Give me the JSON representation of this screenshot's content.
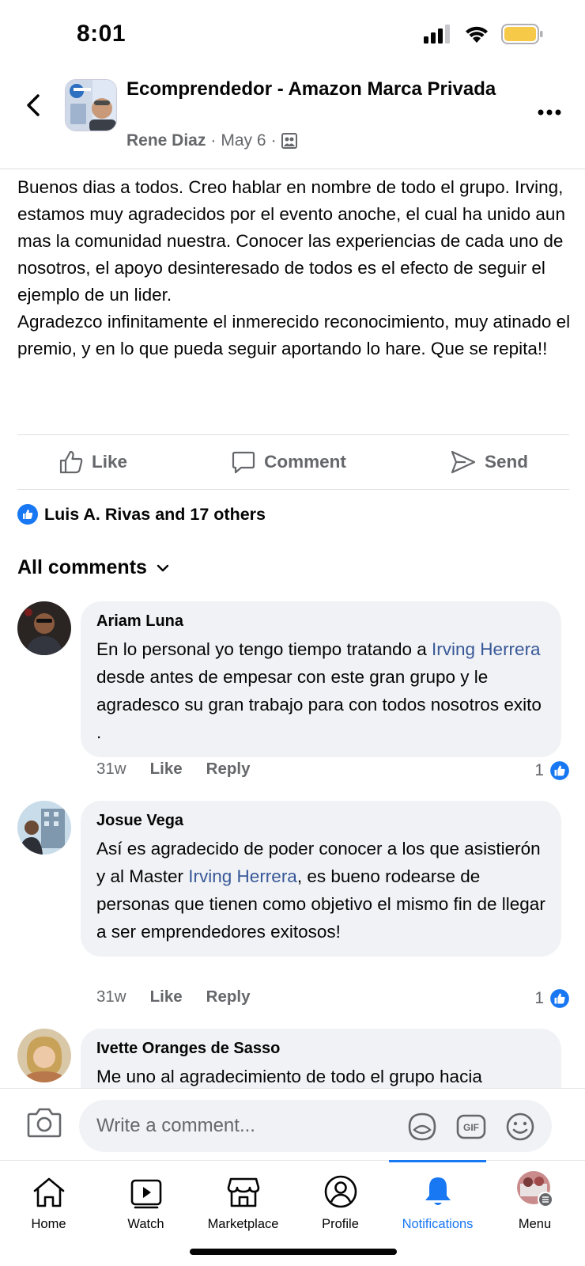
{
  "status_bar": {
    "time": "8:01"
  },
  "header": {
    "group_name": "Ecomprendedor - Amazon Marca Privada",
    "author": "Rene Diaz",
    "separator": "·",
    "date": "May 6",
    "separator2": "·"
  },
  "post": {
    "paragraph1": "Buenos dias a todos. Creo hablar en nombre de todo el grupo. Irving, estamos muy agradecidos por el evento anoche, el cual ha unido aun mas la comunidad nuestra. Conocer las experiencias de cada uno de nosotros, el apoyo desinteresado de todos es el efecto de seguir el ejemplo de un lider.",
    "paragraph2": "Agradezco infinitamente el inmerecido reconocimiento, muy atinado el premio, y en lo que pueda seguir aportando lo hare. Que se repita!!"
  },
  "actions": {
    "like": "Like",
    "comment": "Comment",
    "send": "Send"
  },
  "reactions": {
    "summary": "Luis A. Rivas and 17 others"
  },
  "comments_header": {
    "label": "All comments"
  },
  "comments": [
    {
      "name": "Ariam Luna",
      "text_before": "En lo personal yo tengo tiempo tratando a ",
      "mention": "Irving Herrera",
      "text_after": " desde antes de empesar con este gran grupo y le agradesco su gran trabajo para con todos nosotros exito .",
      "time": "31w",
      "like": "Like",
      "reply": "Reply",
      "reaction_count": "1"
    },
    {
      "name": "Josue Vega",
      "text_before": "Así es agradecido de poder conocer a los que asistierón y al Master ",
      "mention": "Irving Herrera",
      "text_after": ", es bueno rodearse de personas que tienen como objetivo el mismo fin de llegar a ser emprendedores exitosos!",
      "time": "31w",
      "like": "Like",
      "reply": "Reply",
      "reaction_count": "1"
    },
    {
      "name": "Ivette Oranges de Sasso",
      "text_before": "Me uno al agradecimiento de todo el grupo hacia",
      "mention": "",
      "text_after": ""
    }
  ],
  "composer": {
    "placeholder": "Write a comment..."
  },
  "nav": {
    "home": "Home",
    "watch": "Watch",
    "marketplace": "Marketplace",
    "profile": "Profile",
    "notifications": "Notifications",
    "menu": "Menu"
  },
  "colors": {
    "accent": "#1877f2",
    "link": "#385898",
    "bubble": "#f0f2f5",
    "battery": "#f7c948"
  }
}
